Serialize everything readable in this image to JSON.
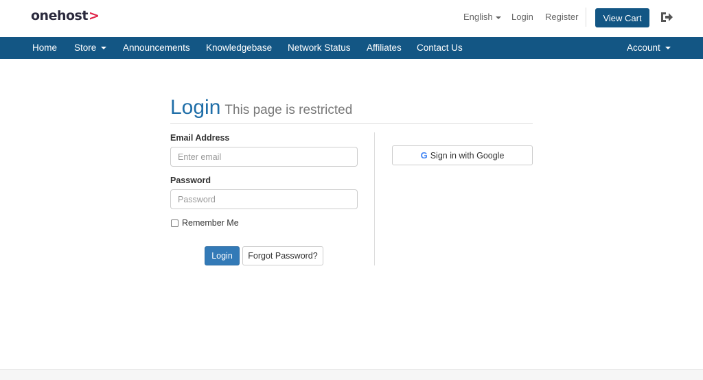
{
  "header": {
    "logo_text": "onehost",
    "logo_mark": ">",
    "language": "English",
    "login": "Login",
    "register": "Register",
    "view_cart": "View Cart",
    "logout_icon": "sign-out-icon"
  },
  "nav": {
    "home": "Home",
    "store": "Store",
    "announcements": "Announcements",
    "knowledgebase": "Knowledgebase",
    "network_status": "Network Status",
    "affiliates": "Affiliates",
    "contact_us": "Contact Us",
    "account": "Account"
  },
  "page": {
    "title": "Login",
    "subtitle": "This page is restricted"
  },
  "form": {
    "email_label": "Email Address",
    "email_placeholder": "Enter email",
    "password_label": "Password",
    "password_placeholder": "Password",
    "remember_me": "Remember Me",
    "login_button": "Login",
    "forgot_button": "Forgot Password?"
  },
  "social": {
    "google_button": "Sign in with Google",
    "google_glyph": "G"
  },
  "colors": {
    "brand_dark": "#135684",
    "primary_button": "#337ab7",
    "logo_accent": "#e0254a",
    "heading": "#1f6ea8"
  }
}
